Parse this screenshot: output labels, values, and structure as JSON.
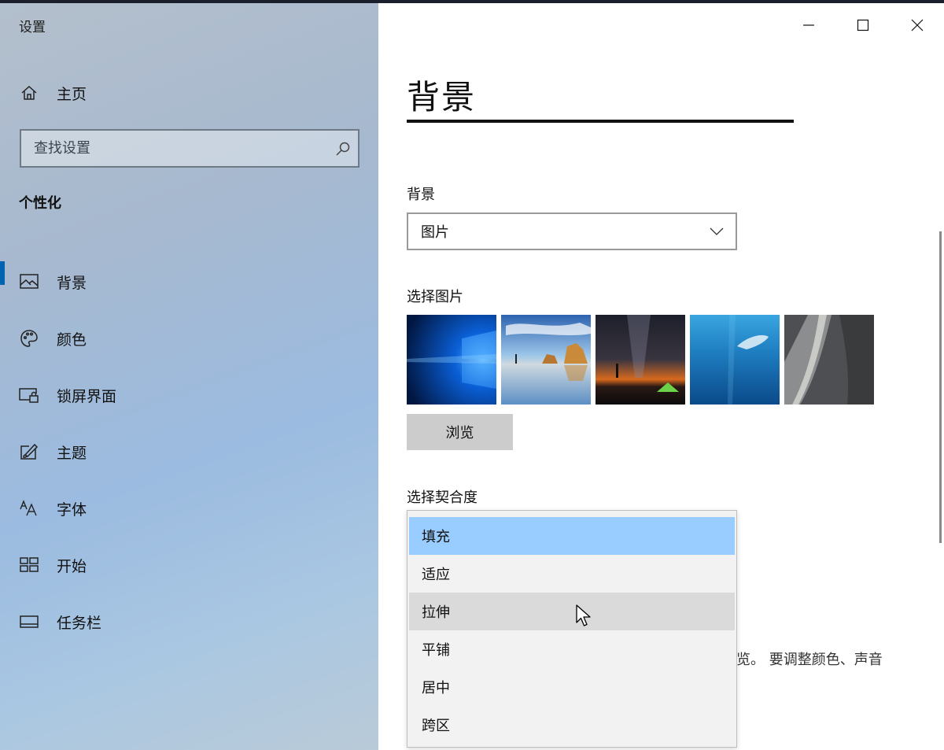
{
  "window": {
    "app_title": "设置",
    "caption": {
      "minimize": "minimize-icon",
      "maximize": "maximize-icon",
      "close": "close-icon"
    }
  },
  "sidebar": {
    "home": {
      "icon": "home-icon",
      "label": "主页"
    },
    "search": {
      "placeholder": "查找设置",
      "icon": "search-icon"
    },
    "section_title": "个性化",
    "items": [
      {
        "icon": "picture-icon",
        "label": "背景",
        "selected": true
      },
      {
        "icon": "palette-icon",
        "label": "颜色"
      },
      {
        "icon": "lock-screen-icon",
        "label": "锁屏界面"
      },
      {
        "icon": "theme-brush-icon",
        "label": "主题"
      },
      {
        "icon": "font-icon",
        "label": "字体"
      },
      {
        "icon": "start-tiles-icon",
        "label": "开始"
      },
      {
        "icon": "taskbar-icon",
        "label": "任务栏"
      }
    ],
    "accent_color": "#0063b1"
  },
  "main": {
    "page_title": "背景",
    "background_label": "背景",
    "background_value": "图片",
    "choose_picture_label": "选择图片",
    "browse_label": "浏览",
    "choose_fit_label": "选择契合度",
    "fit_options": [
      "填充",
      "适应",
      "拉伸",
      "平铺",
      "居中",
      "跨区"
    ],
    "fit_selected": "填充",
    "fit_hovered": "拉伸",
    "hint_text": "览。 要调整颜色、声音"
  },
  "colors": {
    "selected_option": "#99ccff",
    "hovered_option": "#dadada",
    "browse_button": "#cccccc"
  }
}
